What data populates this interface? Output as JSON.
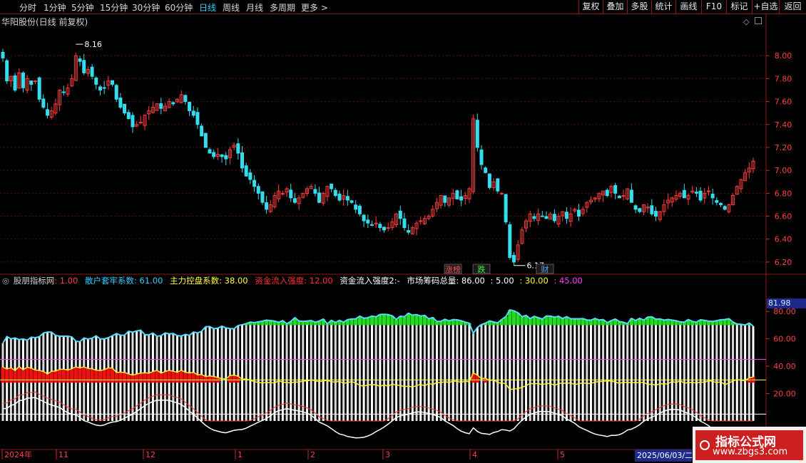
{
  "toolbar": {
    "left_tabs": [
      "分时",
      "1分钟",
      "5分钟",
      "15分钟",
      "30分钟",
      "60分钟",
      "日线",
      "周线",
      "月线",
      "多周期",
      "更多 >"
    ],
    "active_tab": "日线",
    "right_buttons": [
      "复权",
      "叠加",
      "多股",
      "统计",
      "画线",
      "F10",
      "标记",
      "+自选",
      "返回"
    ]
  },
  "main_title": "华阳股份(日线 前复权)",
  "price_axis": {
    "ticks": [
      "8.00",
      "7.80",
      "7.60",
      "7.40",
      "7.20",
      "7.00",
      "6.80",
      "6.60",
      "6.40",
      "6.20"
    ],
    "range": [
      6.1,
      8.2
    ]
  },
  "annotations": {
    "high": "8.16",
    "low": "6.17"
  },
  "badges": [
    {
      "text": "涨榜",
      "color": "#ff5050"
    },
    {
      "text": "跌",
      "color": "#33ff33"
    },
    {
      "text": "财",
      "color": "#5aa0ff"
    }
  ],
  "indicator": {
    "name": "股朋指标网",
    "fields": [
      {
        "label": "股朋指标网",
        "value": "1.00",
        "color": "#ff4040"
      },
      {
        "label": "散户套牢系数",
        "value": "61.00",
        "color": "#33ccff"
      },
      {
        "label": "主力控盘系数",
        "value": "38.00",
        "color": "#ffff33"
      },
      {
        "label": "资金流入强度",
        "value": "12.00",
        "color": "#ff3030"
      },
      {
        "label": "资金流入强度2",
        "value": "-",
        "color": "#ffffff"
      },
      {
        "label": "市场筹码总量",
        "value": "86.00",
        "color": "#ffffff"
      }
    ],
    "extra_values": [
      {
        "value": ": 5.00",
        "color": "#ffffff"
      },
      {
        "value": ": 30.00",
        "color": "#ffff33"
      },
      {
        "value": ": 45.00",
        "color": "#ff40ff"
      }
    ],
    "axis_ticks": [
      "80.00",
      "60.00",
      "40.00",
      "20.00"
    ],
    "highlight_value": "81.98"
  },
  "time_axis": [
    "2024年",
    "11",
    "12",
    "1",
    "2",
    "3",
    "4",
    "5"
  ],
  "date_cursor": "2025/06/03/二",
  "watermark": {
    "line1": "指标公式网",
    "line2": "www.zbgs3.com"
  },
  "chart_data": {
    "type": "candlestick",
    "title": "华阳股份(日线 前复权)",
    "ylim": [
      6.1,
      8.2
    ],
    "x_labels": [
      "2024年",
      "11",
      "12",
      "1",
      "2",
      "3",
      "4",
      "5"
    ],
    "close": [
      7.98,
      7.78,
      7.82,
      7.7,
      7.85,
      7.72,
      7.8,
      7.75,
      7.78,
      7.62,
      7.55,
      7.48,
      7.52,
      7.58,
      7.7,
      7.68,
      7.72,
      7.8,
      8.0,
      7.95,
      7.85,
      7.88,
      7.82,
      7.75,
      7.7,
      7.72,
      7.78,
      7.75,
      7.62,
      7.55,
      7.5,
      7.45,
      7.38,
      7.4,
      7.42,
      7.48,
      7.52,
      7.55,
      7.58,
      7.54,
      7.56,
      7.6,
      7.58,
      7.62,
      7.66,
      7.6,
      7.52,
      7.48,
      7.4,
      7.3,
      7.2,
      7.15,
      7.12,
      7.14,
      7.12,
      7.1,
      7.18,
      7.22,
      7.15,
      7.02,
      6.95,
      6.92,
      6.86,
      6.8,
      6.72,
      6.66,
      6.7,
      6.78,
      6.82,
      6.8,
      6.84,
      6.76,
      6.72,
      6.76,
      6.8,
      6.84,
      6.86,
      6.8,
      6.72,
      6.8,
      6.86,
      6.84,
      6.78,
      6.74,
      6.78,
      6.74,
      6.72,
      6.66,
      6.62,
      6.56,
      6.54,
      6.52,
      6.54,
      6.5,
      6.48,
      6.5,
      6.55,
      6.62,
      6.58,
      6.5,
      6.46,
      6.5,
      6.54,
      6.56,
      6.58,
      6.6,
      6.66,
      6.72,
      6.78,
      6.72,
      6.76,
      6.8,
      6.75,
      6.74,
      6.78,
      6.84,
      7.45,
      7.2,
      7.05,
      6.98,
      6.85,
      6.9,
      6.82,
      6.8,
      6.55,
      6.24,
      6.2,
      6.35,
      6.48,
      6.56,
      6.62,
      6.58,
      6.62,
      6.6,
      6.58,
      6.62,
      6.56,
      6.6,
      6.64,
      6.58,
      6.62,
      6.66,
      6.6,
      6.66,
      6.72,
      6.74,
      6.76,
      6.8,
      6.82,
      6.78,
      6.86,
      6.8,
      6.76,
      6.78,
      6.84,
      6.72,
      6.66,
      6.64,
      6.7,
      6.68,
      6.62,
      6.6,
      6.64,
      6.7,
      6.74,
      6.76,
      6.78,
      6.8,
      6.76,
      6.78,
      6.82,
      6.8,
      6.74,
      6.8,
      6.82,
      6.76,
      6.72,
      6.7,
      6.66,
      6.7,
      6.78,
      6.86,
      6.92,
      6.98,
      7.02,
      7.08
    ]
  }
}
